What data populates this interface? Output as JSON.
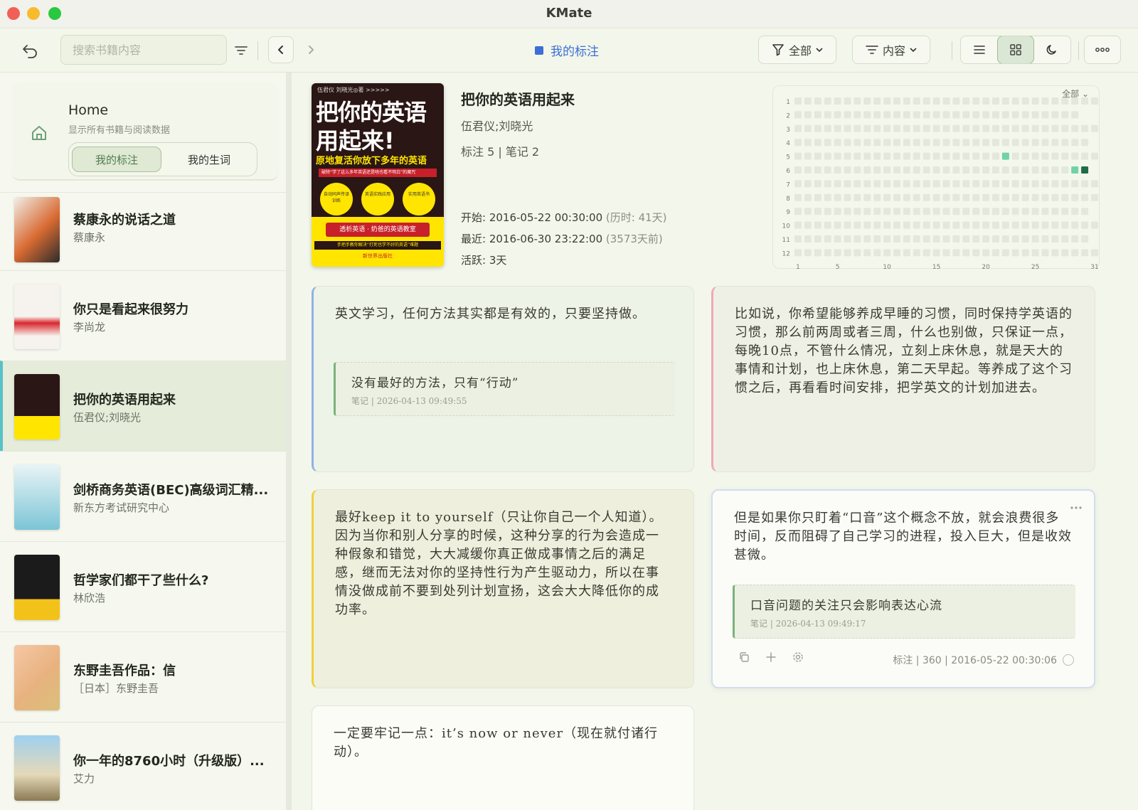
{
  "window": {
    "title": "KMate"
  },
  "toolbar": {
    "search_placeholder": "搜索书籍内容",
    "section_title": "我的标注",
    "filter_label": "全部",
    "sort_label": "内容"
  },
  "sidebar": {
    "home": {
      "title": "Home",
      "subtitle": "显示所有书籍与阅读数据",
      "tab_highlights": "我的标注",
      "tab_vocab": "我的生词"
    },
    "books": [
      {
        "title": "蔡康永的说话之道",
        "author": "蔡康永"
      },
      {
        "title": "你只是看起来很努力",
        "author": "李尚龙"
      },
      {
        "title": "把你的英语用起来",
        "author": "伍君仪;刘晓光"
      },
      {
        "title": "剑桥商务英语(BEC)高级词汇精...",
        "author": "新东方考试研究中心"
      },
      {
        "title": "哲学家们都干了些什么?",
        "author": "林欣浩"
      },
      {
        "title": "东野圭吾作品：信",
        "author": "［日本］东野圭吾"
      },
      {
        "title": "你一年的8760小时（升级版）...",
        "author": "艾力"
      }
    ]
  },
  "book": {
    "title": "把你的英语用起来",
    "author": "伍君仪;刘晓光",
    "counts": "标注 5 | 笔记 2",
    "start_label": "开始: ",
    "start_value": "2016-05-22 00:30:00",
    "start_extra": " (历时: 41天)",
    "recent_label": "最近: ",
    "recent_value": "2016-06-30 23:22:00",
    "recent_extra": " (3573天前)",
    "active_label": "活跃: ",
    "active_value": "3天",
    "cover": {
      "top": "伍君仪  刘晓光◎著  >>>>>",
      "line1": "把你的英语",
      "line2": "用起来!",
      "subtitle": "原地复活你放下多年的英语",
      "red_bar": "破除“学了这么多年英语还是啥也看不明白”的魔咒",
      "circle1": "自动同声传译训练",
      "circle2": "英语实践应用",
      "circle3": "实用英语书",
      "band1": "透析英语 · 奶爸的英语教室",
      "band2": "手把手教你解决“打死也学不好的英语”难题",
      "publisher": "新世界出版社"
    }
  },
  "heatmap": {
    "filter": "全部",
    "rows": [
      "1",
      "2",
      "3",
      "4",
      "5",
      "6",
      "7",
      "8",
      "9",
      "10",
      "11",
      "12"
    ],
    "x_ticks": [
      "1",
      "5",
      "10",
      "15",
      "20",
      "25",
      "31"
    ],
    "active": [
      {
        "month": 5,
        "day": 22,
        "level": 1
      },
      {
        "month": 6,
        "day": 29,
        "level": 1
      },
      {
        "month": 6,
        "day": 30,
        "level": 2
      }
    ],
    "colors": {
      "empty": "#e4e8dc",
      "l1": "#6fd3a6",
      "l2": "#1f6b4a"
    }
  },
  "cards": [
    {
      "text": "英文学习，任何方法其实都是有效的，只要坚持做。",
      "note": "没有最好的方法，只有“行动”",
      "note_meta": "笔记 | 2026-04-13 09:49:55",
      "accent": "#8fb1e6"
    },
    {
      "text": "比如说，你希望能够养成早睡的习惯，同时保持学英语的习惯，那么前两周或者三周，什么也别做，只保证一点，每晚10点，不管什么情况，立刻上床休息，就是天大的事情和计划，也上床休息，第二天早起。等养成了这个习惯之后，再看看时间安排，把学英文的计划加进去。",
      "accent": "#f0a8b8"
    },
    {
      "text": "最好keep it to yourself（只让你自己一个人知道）。因为当你和别人分享的时候，这种分享的行为会造成一种假象和错觉，大大减缓你真正做成事情之后的满足感，继而无法对你的坚持性行为产生驱动力，所以在事情没做成前不要到处列计划宣扬，这会大大降低你的成功率。",
      "accent": "#f2cf3f"
    },
    {
      "text": "但是如果你只盯着“口音”这个概念不放，就会浪费很多时间，反而阻碍了自己学习的进程，投入巨大，但是收效甚微。",
      "note": "口音问题的关注只会影响表达心流",
      "note_meta": "笔记 | 2026-04-13 09:49:17",
      "meta": "标注 | 360 | 2016-05-22 00:30:06"
    },
    {
      "text": "一定要牢记一点：it’s now or never（现在就付诸行动）。"
    }
  ]
}
